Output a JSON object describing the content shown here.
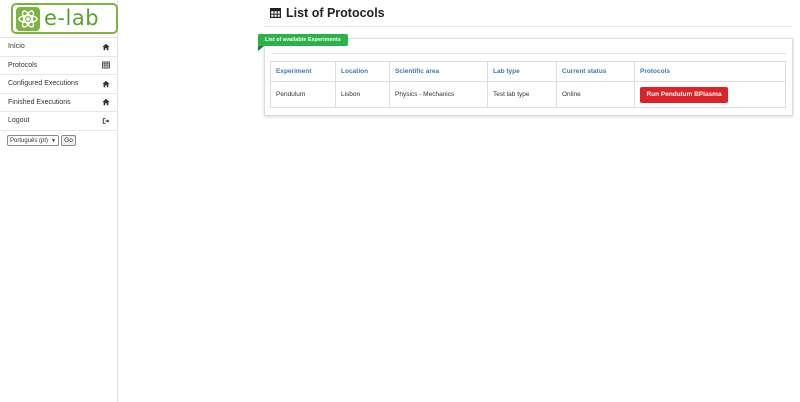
{
  "brand": {
    "name": "e-lab",
    "accent": "#5aa02c"
  },
  "sidebar": {
    "items": [
      {
        "label": "Início",
        "icon": "home-icon"
      },
      {
        "label": "Protocols",
        "icon": "table-icon"
      },
      {
        "label": "Configured Executions",
        "icon": "home-icon"
      },
      {
        "label": "Finished Executions",
        "icon": "home-icon"
      },
      {
        "label": "Logout",
        "icon": "sign-out-icon"
      }
    ],
    "language": {
      "selected": "Português (pt)",
      "go_label": "Go"
    }
  },
  "main": {
    "title": "List of Protocols",
    "title_icon": "table-icon",
    "panel_label": "List of available Experiments",
    "panel_label_color": "#2bb34a",
    "table": {
      "headers": [
        "Experiment",
        "Location",
        "Scientific area",
        "Lab type",
        "Current status",
        "Protocols"
      ],
      "rows": [
        {
          "experiment": "Pendulum",
          "location": "Lisbon",
          "scientific_area": "Physics - Mechanics",
          "lab_type": "Test lab type",
          "status": "Online",
          "action_label": "Run Pendulum BPlasma"
        }
      ],
      "header_color": "#3a7ab8",
      "action_color": "#dc2428"
    }
  }
}
